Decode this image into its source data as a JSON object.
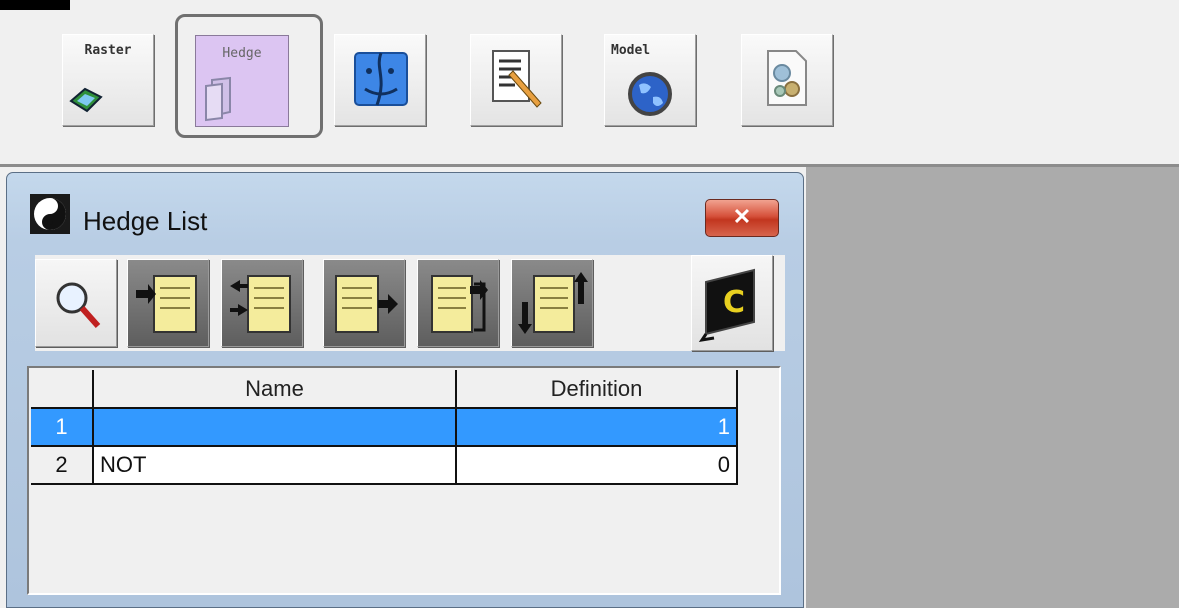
{
  "toolbar": {
    "buttons": [
      {
        "id": "raster",
        "label": "Raster",
        "icon": "raster-map-icon"
      },
      {
        "id": "hedge",
        "label": "Hedge",
        "icon": "hedge-document-icon",
        "active": true
      },
      {
        "id": "finder",
        "label": "",
        "icon": "finder-face-icon"
      },
      {
        "id": "editor",
        "label": "",
        "icon": "document-edit-icon"
      },
      {
        "id": "model",
        "label": "Model",
        "icon": "globe-icon"
      },
      {
        "id": "settings",
        "label": "",
        "icon": "gears-document-icon"
      }
    ]
  },
  "dialog": {
    "title": "Hedge List",
    "close_label": "✕",
    "tools": [
      {
        "id": "search",
        "icon": "magnifier-icon"
      },
      {
        "id": "import",
        "icon": "note-import-icon"
      },
      {
        "id": "swap",
        "icon": "note-swap-icon"
      },
      {
        "id": "export",
        "icon": "note-export-icon"
      },
      {
        "id": "copy",
        "icon": "note-copy-icon"
      },
      {
        "id": "sort",
        "icon": "note-sort-icon"
      },
      {
        "id": "compile",
        "icon": "compile-c-icon"
      }
    ]
  },
  "grid": {
    "columns": [
      "Name",
      "Definition"
    ],
    "rows": [
      {
        "num": "1",
        "name": "",
        "definition": "1",
        "selected": true
      },
      {
        "num": "2",
        "name": "NOT",
        "definition": "0",
        "selected": false
      }
    ]
  },
  "colors": {
    "selection": "#3399ff",
    "active_button": "#dcc5f2",
    "close": "#c2361f"
  }
}
